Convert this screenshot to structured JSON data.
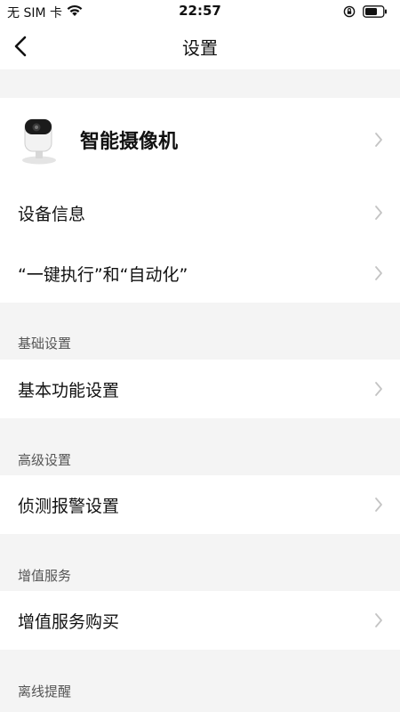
{
  "status_bar": {
    "carrier": "无 SIM 卡",
    "time": "22:57"
  },
  "nav": {
    "title": "设置"
  },
  "device": {
    "name": "智能摄像机"
  },
  "rows": {
    "device_info": "设备信息",
    "one_tap_automation": "“一键执行”和“自动化”",
    "basic_function": "基本功能设置",
    "detection_alarm": "侦测报警设置",
    "value_added_purchase": "增值服务购买"
  },
  "sections": {
    "basic": "基础设置",
    "advanced": "高级设置",
    "value_added": "增值服务",
    "offline": "离线提醒"
  },
  "icons": [
    "wifi-icon",
    "orientation-lock-icon",
    "battery-icon",
    "back-arrow-icon",
    "camera-icon",
    "chevron-right-icon"
  ]
}
